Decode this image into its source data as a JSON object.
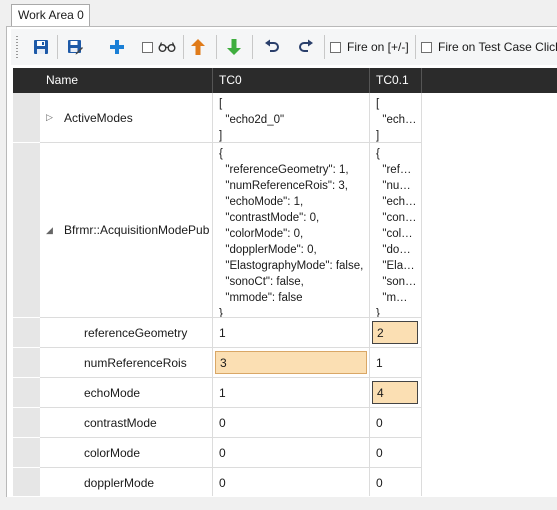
{
  "tabs": [
    {
      "label": "Work Area 0"
    }
  ],
  "toolbar": {
    "icons": [
      "save-icon",
      "save-as-icon",
      "add-icon",
      "glasses-icon",
      "move-up-icon",
      "move-down-icon",
      "undo-icon",
      "redo-icon"
    ],
    "fire_on_label": "Fire on [+/-]",
    "fire_on_testcase_label": "Fire on Test Case Click",
    "colors": {
      "save": "#1e5aa8",
      "add": "#1a7fd6",
      "up": "#e07b1a",
      "down": "#3fae3f"
    }
  },
  "grid": {
    "columns": [
      "Name",
      "TC0",
      "TC0.1"
    ],
    "rows": [
      {
        "name": "ActiveModes",
        "expander": "▷",
        "tc0": "[\n  \"echo2d_0\"\n]",
        "tc01": "[\n  \"ech…\n]"
      },
      {
        "name": "Bfrmr::AcquisitionModePub",
        "expander": "◢",
        "tc0": "{\n  \"referenceGeometry\": 1,\n  \"numReferenceRois\": 3,\n  \"echoMode\": 1,\n  \"contrastMode\": 0,\n  \"colorMode\": 0,\n  \"dopplerMode\": 0,\n  \"ElastographyMode\": false,\n  \"sonoCt\": false,\n  \"mmode\": false\n}",
        "tc01": "{\n  \"ref…\n  \"nu…\n  \"ech…\n  \"con…\n  \"col…\n  \"do…\n  \"Ela…\n  \"son…\n  \"m…\n}"
      },
      {
        "name": "referenceGeometry",
        "tc0": "1",
        "tc01": "2"
      },
      {
        "name": "numReferenceRois",
        "tc0": "3",
        "tc01": "1"
      },
      {
        "name": "echoMode",
        "tc0": "1",
        "tc01": "4"
      },
      {
        "name": "contrastMode",
        "tc0": "0",
        "tc01": "0"
      },
      {
        "name": "colorMode",
        "tc0": "0",
        "tc01": "0"
      },
      {
        "name": "dopplerMode",
        "tc0": "0",
        "tc01": "0"
      }
    ],
    "highlight_color": "#fbdfb3"
  }
}
